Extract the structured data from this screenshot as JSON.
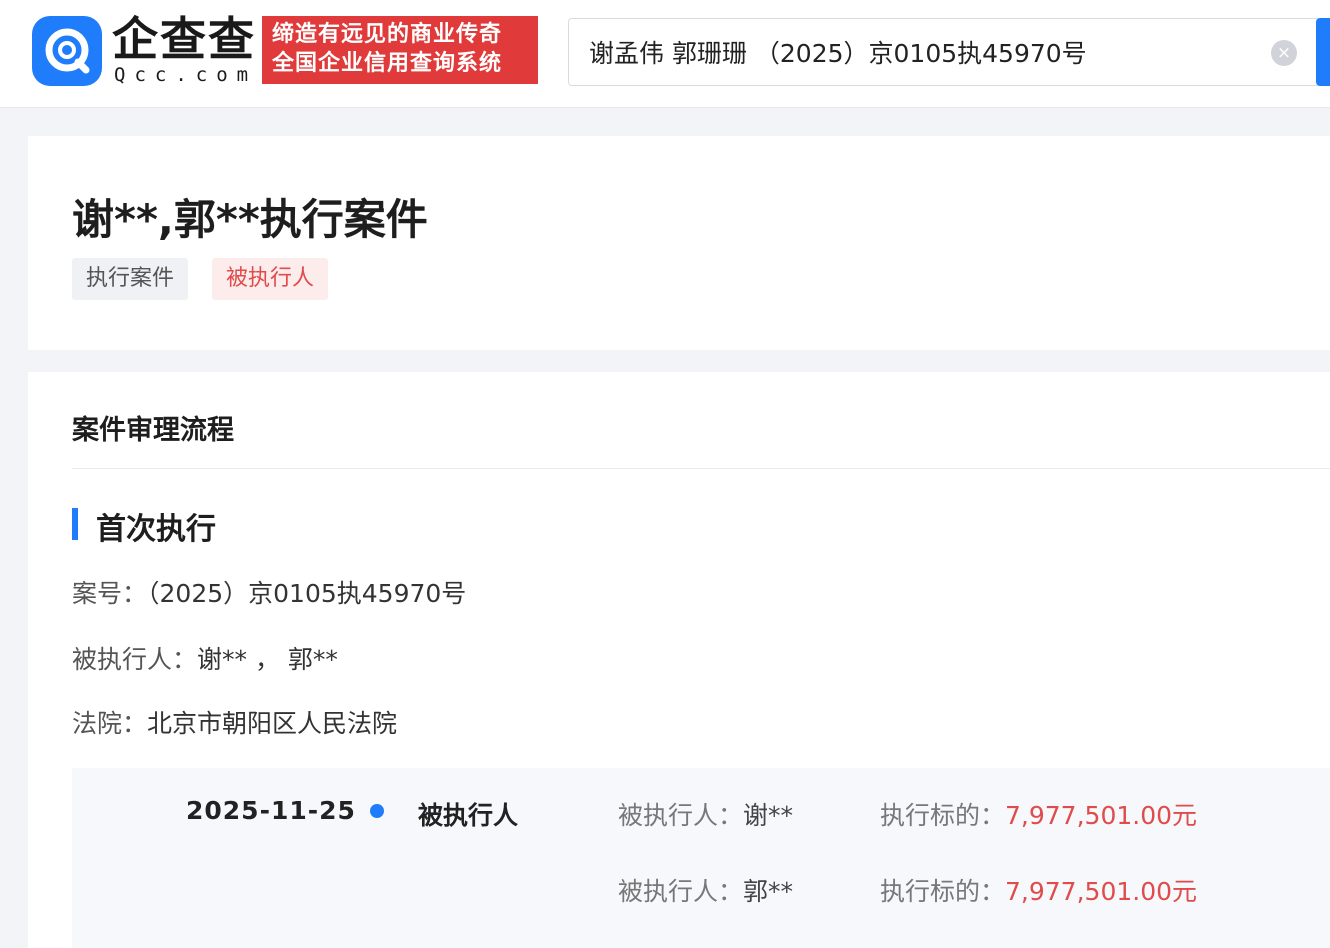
{
  "header": {
    "logo_text": "企查查",
    "logo_sub": "Qcc.com",
    "slogan_line1": "缔造有远见的商业传奇",
    "slogan_line2": "全国企业信用查询系统",
    "search_value": "谢孟伟 郭珊珊 （2025）京0105执45970号",
    "clear_icon": "×"
  },
  "case": {
    "title": "谢**,郭**执行案件",
    "tags": [
      "执行案件",
      "被执行人"
    ]
  },
  "process": {
    "section_title": "案件审理流程",
    "sub_title": "首次执行",
    "case_no_label": "案号：",
    "case_no": "（2025）京0105执45970号",
    "executed_label": "被执行人：",
    "executed_value": "谢** ， 郭**",
    "court_label": "法院：",
    "court_value": "北京市朝阳区人民法院",
    "timeline": {
      "date": "2025-11-25",
      "event": "被执行人",
      "items": [
        {
          "person_label": "被执行人：",
          "person": "谢**",
          "amount_label": "执行标的：",
          "amount": "7,977,501.00元"
        },
        {
          "person_label": "被执行人：",
          "person": "郭**",
          "amount_label": "执行标的：",
          "amount": "7,977,501.00元"
        }
      ]
    }
  },
  "colors": {
    "brand_blue": "#1f7dfb",
    "accent_red": "#e04b4b"
  }
}
